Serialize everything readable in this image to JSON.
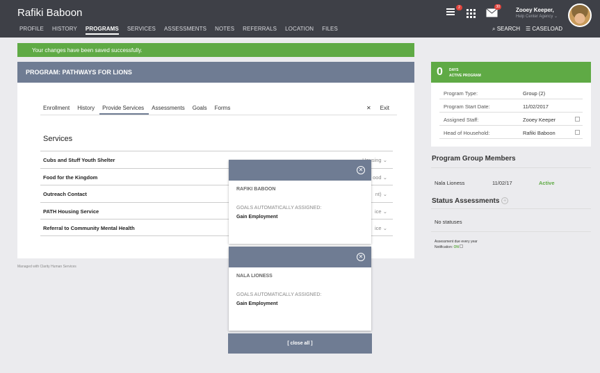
{
  "header": {
    "client_name": "Rafiki Baboon",
    "nav": [
      "PROFILE",
      "HISTORY",
      "PROGRAMS",
      "SERVICES",
      "ASSESSMENTS",
      "NOTES",
      "REFERRALS",
      "LOCATION",
      "FILES"
    ],
    "active_nav": "PROGRAMS",
    "alerts_badge": "2",
    "messages_badge": "30",
    "user_name": "Zooey Keeper,",
    "user_agency": "Help Center Agency",
    "search_label": "SEARCH",
    "caseload_label": "CASELOAD"
  },
  "banner": {
    "message": "Your changes have been saved successfully."
  },
  "program": {
    "title": "PROGRAM: PATHWAYS FOR LIONS",
    "tabs": [
      "Enrollment",
      "History",
      "Provide Services",
      "Assessments",
      "Goals",
      "Forms"
    ],
    "active_tab": "Provide Services",
    "exit_label": "Exit"
  },
  "services": {
    "title": "Services",
    "rows": [
      {
        "name": "Cubs and Stuff Youth Shelter",
        "type": "Housing"
      },
      {
        "name": "Food for the Kingdom",
        "type": "ood"
      },
      {
        "name": "Outreach Contact",
        "type": "nt)"
      },
      {
        "name": "PATH Housing Service",
        "type": "ice"
      },
      {
        "name": "Referral to Community Mental Health",
        "type": "ice"
      }
    ]
  },
  "footer": {
    "managed_with": "Managed with Clarity Human Services"
  },
  "sidebar": {
    "days": "0",
    "days_label_1": "DAYS",
    "days_label_2": "ACTIVE PROGRAM",
    "info": [
      {
        "label": "Program Type:",
        "value": "Group (2)"
      },
      {
        "label": "Program Start Date:",
        "value": "11/02/2017"
      },
      {
        "label": "Assigned Staff:",
        "value": "Zooey Keeper"
      },
      {
        "label": "Head of Household:",
        "value": "Rafiki Baboon"
      }
    ],
    "group_members_title": "Program Group Members",
    "member": {
      "name": "Nala Lioness",
      "date": "11/02/17",
      "status": "Active"
    },
    "status_title": "Status Assessments",
    "no_statuses": "No statuses",
    "assessment_due": "Assessment due every year",
    "notification_label": "Notification:",
    "notification_value": "ON"
  },
  "popups": [
    {
      "name": "RAFIKI BABOON",
      "goals_label": "GOALS AUTOMATICALLY ASSIGNED:",
      "goal": "Gain Employment"
    },
    {
      "name": "NALA LIONESS",
      "goals_label": "GOALS AUTOMATICALLY ASSIGNED:",
      "goal": "Gain Employment"
    }
  ],
  "close_all_label": "[ close all ]",
  "colors": {
    "header_bg": "#3e4047",
    "success": "#5faa45",
    "slate": "#6f7c93"
  }
}
